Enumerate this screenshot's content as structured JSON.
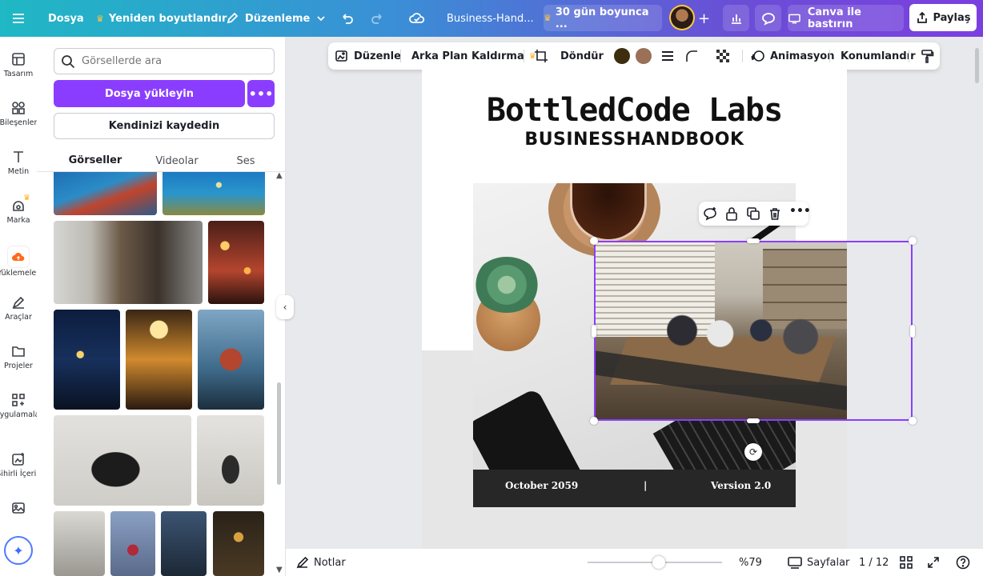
{
  "topbar": {
    "file_label": "Dosya",
    "resize_label": "Yeniden boyutlandır",
    "edit_label": "Düzenleme",
    "doc_title": "Business-Hand...",
    "trial_label": "30 gün boyunca ...",
    "print_label": "Canva ile bastırın",
    "share_label": "Paylaş"
  },
  "rail": {
    "items": [
      {
        "label": "Tasarım",
        "icon": "layout-icon"
      },
      {
        "label": "Bileşenler",
        "icon": "shapes-icon"
      },
      {
        "label": "Metin",
        "icon": "text-icon"
      },
      {
        "label": "Marka",
        "icon": "brand-icon"
      },
      {
        "label": "Yüklemeler",
        "icon": "upload-cloud-icon"
      },
      {
        "label": "Araçlar",
        "icon": "pen-icon"
      },
      {
        "label": "Projeler",
        "icon": "folder-icon"
      },
      {
        "label": "Uygulamalar",
        "icon": "apps-icon"
      },
      {
        "label": "Sihirli İçerik",
        "icon": "magic-media-icon"
      },
      {
        "label": "",
        "icon": "image-icon"
      }
    ]
  },
  "panel": {
    "search_placeholder": "Görsellerde ara",
    "upload_label": "Dosya yükleyin",
    "record_label": "Kendinizi kaydedin",
    "tabs": [
      "Görseller",
      "Videolar",
      "Ses"
    ]
  },
  "toolbar": {
    "edit": "Düzenle",
    "bg_remove": "Arka Plan Kaldırma",
    "flip": "Döndür",
    "animate": "Animasyon",
    "position": "Konumlandır",
    "colors": [
      "#3d2e10",
      "#9a7058"
    ]
  },
  "canvas": {
    "title": "BottledCode Labs",
    "subtitle": "BUSINESSHANDBOOK",
    "date": "October 2059",
    "divider": "|",
    "version": "Version 2.0"
  },
  "bottom": {
    "notes": "Notlar",
    "zoom": "%79",
    "pages_label": "Sayfalar",
    "page_count": "1 / 12"
  }
}
